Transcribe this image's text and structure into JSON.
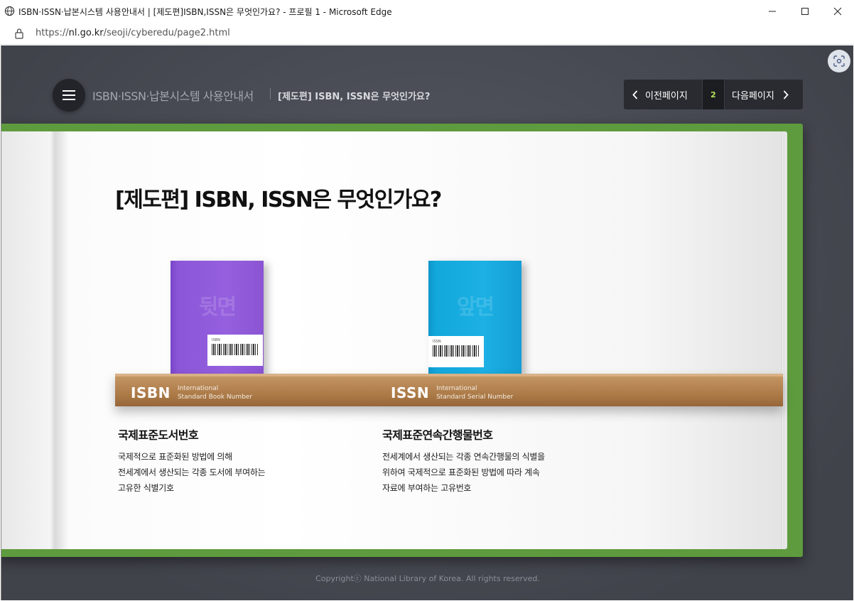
{
  "window": {
    "title": "ISBN·ISSN·납본시스템 사용안내서 | [제도편]ISBN,ISSN은 무엇인가요? - 프로필 1 - Microsoft Edge",
    "icon": "globe-icon",
    "controls": {
      "minimize": "minimize-icon",
      "maximize": "maximize-icon",
      "close": "close-icon"
    }
  },
  "address": {
    "prefix": "https://",
    "host": "nl.go.kr",
    "path": "/seoji/cyberedu/page2.html"
  },
  "header": {
    "site_name": "ISBN·ISSN·납본시스템 사용안내서",
    "section": "[제도편] ISBN, ISSN은 무엇인가요?",
    "pager": {
      "prev": "이전페이지",
      "current": "2",
      "next": "다음페이지"
    }
  },
  "content": {
    "title": "[제도편] ISBN, ISSN은 무엇인가요?",
    "isbn": {
      "cover_word": "뒷면",
      "barcode_title": "ISBN",
      "shelf_abbr": "ISBN",
      "shelf_full_1": "International",
      "shelf_full_2": "Standard Book Number",
      "desc_title": "국제표준도서번호",
      "desc_lines": [
        "국제적으로 표준화된 방법에 의해",
        "전세계에서 생산되는 각종 도서에 부여하는",
        "고유한 식별기호"
      ]
    },
    "issn": {
      "cover_word": "앞면",
      "barcode_title": "ISSN",
      "shelf_abbr": "ISSN",
      "shelf_full_1": "International",
      "shelf_full_2": "Standard Serial Number",
      "desc_title": "국제표준연속간행물번호",
      "desc_lines": [
        "전세계에서 생산되는 각종 연속간행물의 식별을",
        "위하여 국제적으로 표준화된 방법에 따라 계속",
        "자료에 부여하는 고유번호"
      ]
    }
  },
  "footer": {
    "copyright": "Copyrightⓒ National Library of Korea. All rights reserved."
  },
  "colors": {
    "accent": "#b6e25a",
    "cover_green": "#5e9b3e",
    "isbn_book": "#9560de",
    "issn_book": "#1cb0e4",
    "page_bg": "#4a4c56"
  }
}
